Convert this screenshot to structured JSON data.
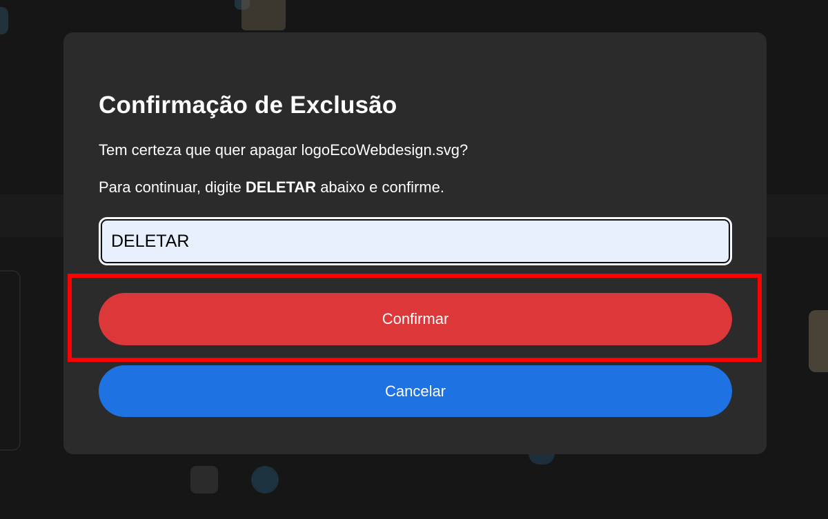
{
  "dialog": {
    "title": "Confirmação de Exclusão",
    "message": "Tem certeza que quer apagar logoEcoWebdesign.svg?",
    "instruction_prefix": "Para continuar, digite ",
    "instruction_keyword": "DELETAR",
    "instruction_suffix": " abaixo e confirme.",
    "input_value": "DELETAR",
    "confirm_label": "Confirmar",
    "cancel_label": "Cancelar"
  },
  "colors": {
    "modal_background": "#2b2b2b",
    "confirm_button": "#dc3739",
    "cancel_button": "#1e72e2",
    "input_background": "#e8f0fe",
    "highlight": "#ff0000"
  },
  "icons": {
    "background_folder": "folder-icon"
  }
}
